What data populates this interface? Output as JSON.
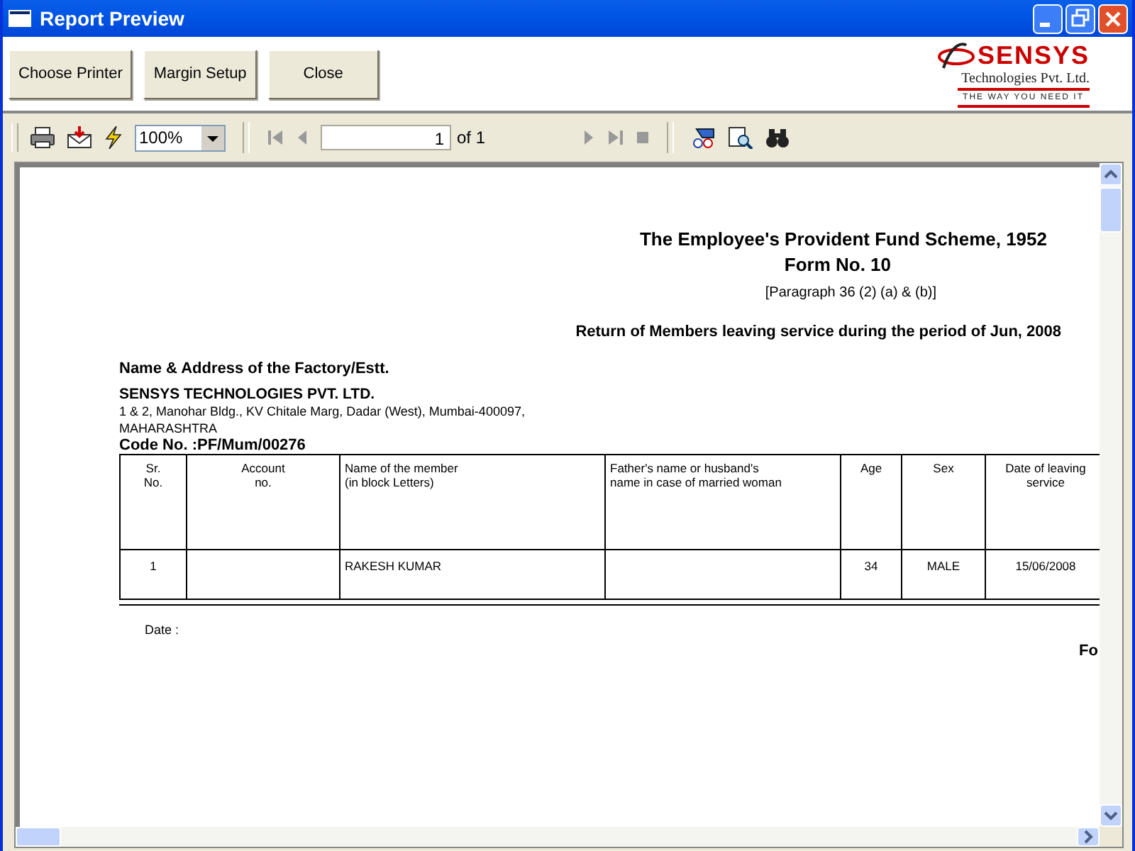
{
  "window": {
    "title": "Report Preview"
  },
  "buttons": [
    {
      "label": "Choose Printer"
    },
    {
      "label": "Margin Setup"
    },
    {
      "label": "Close"
    }
  ],
  "logo": {
    "name": "SENSYS",
    "subtitle": "Technologies Pvt. Ltd.",
    "tagline": "THE WAY YOU NEED IT"
  },
  "toolbar": {
    "zoom": "100%",
    "page": "1",
    "page_count": "of 1"
  },
  "report": {
    "title": "The Employee's Provident Fund Scheme, 1952",
    "form": "Form No. 10",
    "paragraph": "[Paragraph 36 (2) (a) & (b)]",
    "period": "Return of Members leaving service during the period of Jun, 2008",
    "address_heading": "Name & Address of the Factory/Estt.",
    "company": "SENSYS TECHNOLOGIES PVT. LTD.",
    "address_lines": [
      "1 & 2, Manohar Bldg., KV Chitale Marg, Dadar (West), Mumbai-400097,",
      "MAHARASHTRA"
    ],
    "code": "Code No.  :PF/Mum/00276",
    "table": {
      "columns": [
        {
          "label": "Sr.\nNo."
        },
        {
          "label": "Account\nno."
        },
        {
          "label": "Name of the  member\n(in block Letters)"
        },
        {
          "label": "Father's name or husband's\nname in case of married woman"
        },
        {
          "label": "Age"
        },
        {
          "label": "Sex"
        },
        {
          "label": "Date of leaving\nservice"
        }
      ],
      "rows": [
        [
          "1",
          "",
          "RAKESH  KUMAR",
          "",
          "34",
          "MALE",
          "15/06/2008"
        ]
      ]
    },
    "date_label": "Date :",
    "column_cut": "Fo"
  }
}
